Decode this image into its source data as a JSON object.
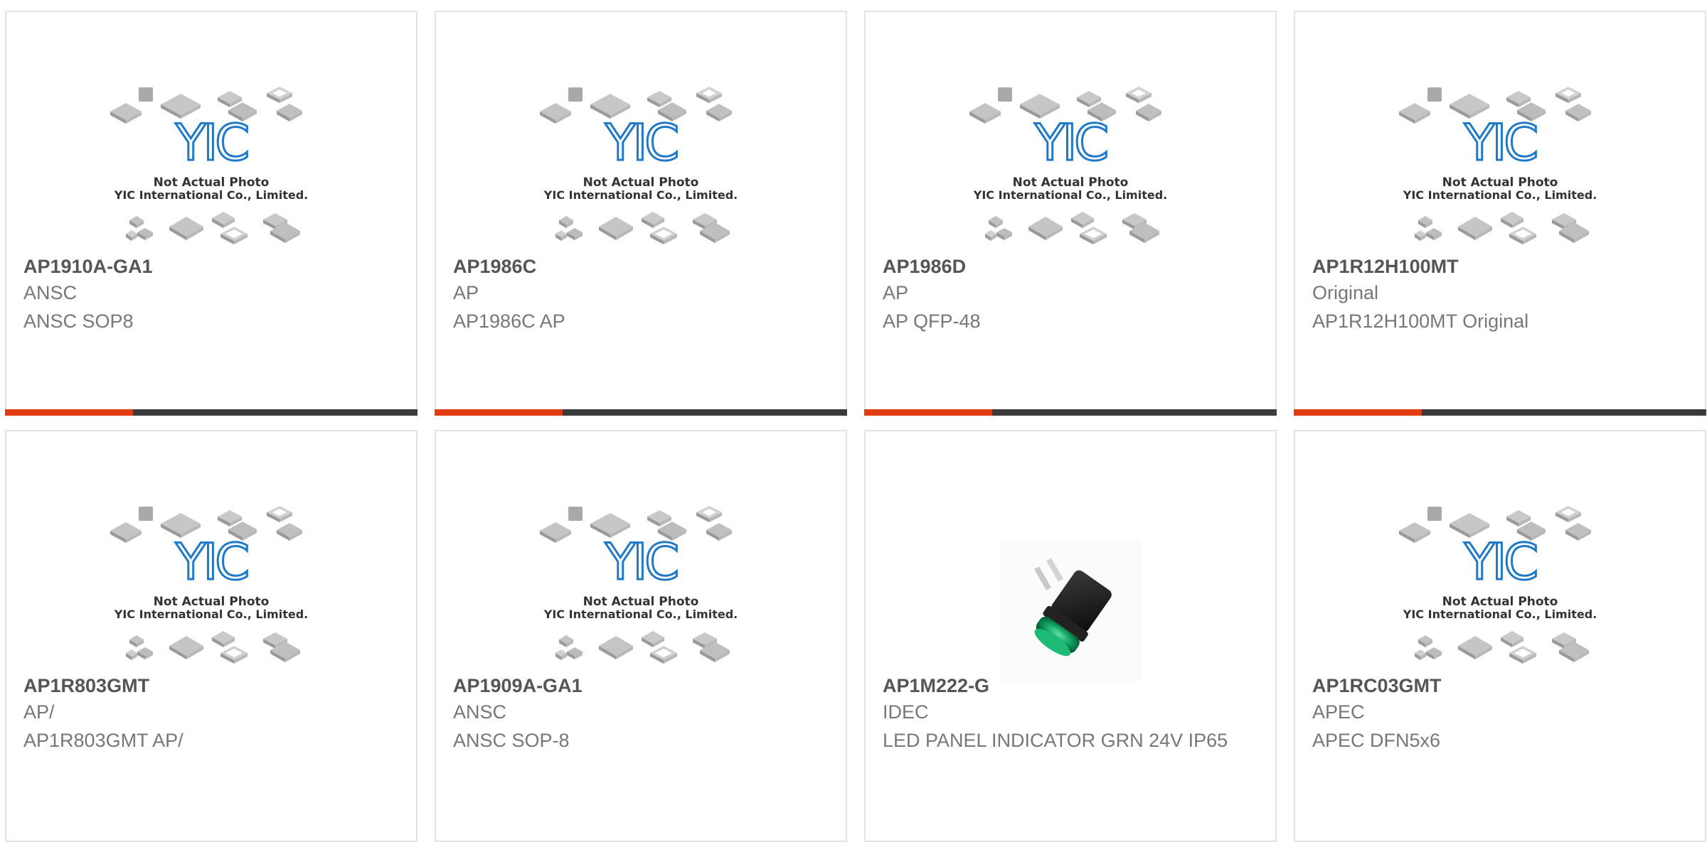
{
  "placeholder": {
    "brand_mark": "YIC",
    "line1": "Not Actual Photo",
    "line2": "YIC International Co., Limited."
  },
  "accent_color": "#e03c12",
  "bar_color": "#3a3a3a",
  "bar_accent_fraction": 0.31,
  "products": [
    {
      "part_number": "AP1910A-GA1",
      "brand": "ANSC",
      "description": "ANSC SOP8",
      "image": "placeholder"
    },
    {
      "part_number": "AP1986C",
      "brand": "AP",
      "description": "AP1986C AP",
      "image": "placeholder"
    },
    {
      "part_number": "AP1986D",
      "brand": "AP",
      "description": "AP QFP-48",
      "image": "placeholder"
    },
    {
      "part_number": "AP1R12H100MT",
      "brand": "Original",
      "description": "AP1R12H100MT Original",
      "image": "placeholder"
    },
    {
      "part_number": "AP1R803GMT",
      "brand": "AP/",
      "description": "AP1R803GMT AP/",
      "image": "placeholder"
    },
    {
      "part_number": "AP1909A-GA1",
      "brand": "ANSC",
      "description": "ANSC SOP-8",
      "image": "placeholder"
    },
    {
      "part_number": "AP1M222-G",
      "brand": "IDEC",
      "description": "LED PANEL INDICATOR GRN 24V IP65",
      "image": "led-indicator-photo"
    },
    {
      "part_number": "AP1RC03GMT",
      "brand": "APEC",
      "description": "APEC DFN5x6",
      "image": "placeholder"
    }
  ]
}
